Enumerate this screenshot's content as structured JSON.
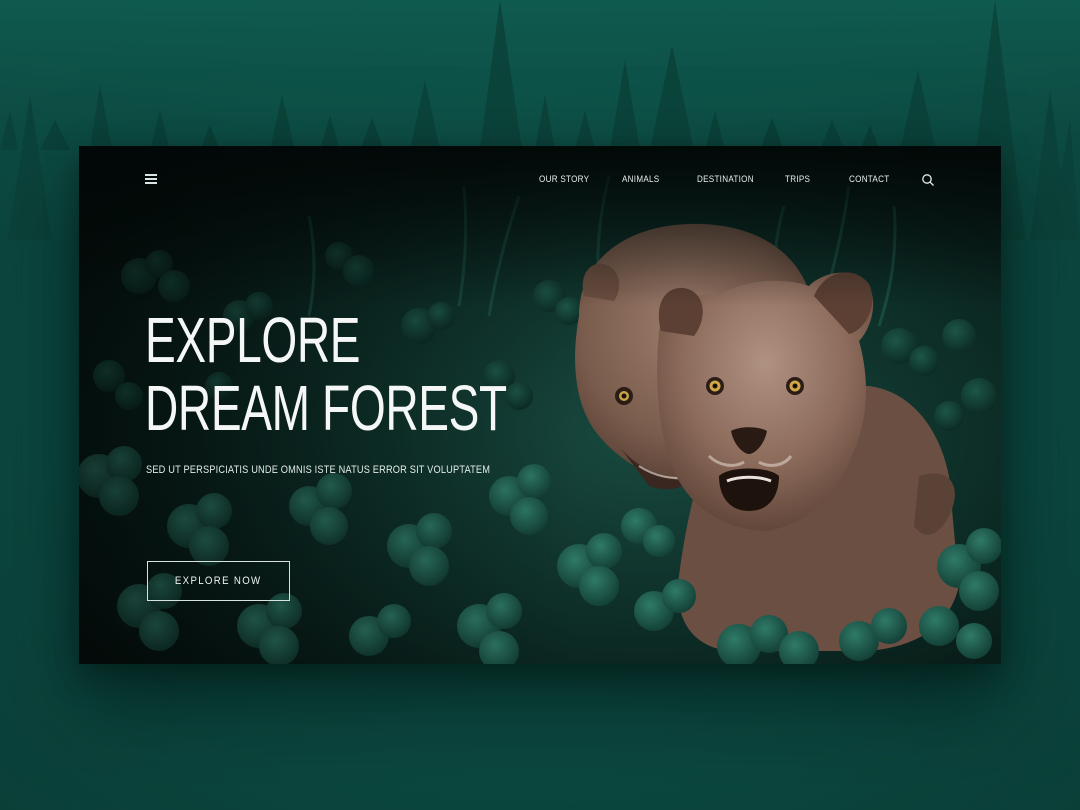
{
  "nav": {
    "menu_icon": "hamburger-menu-icon",
    "links": [
      "OUR STORY",
      "ANIMALS",
      "DESTINATION",
      "TRIPS",
      "CONTACT"
    ],
    "search_icon": "search-icon"
  },
  "hero": {
    "title_line1": "EXPLORE",
    "title_line2": "DREAM FOREST",
    "subtitle": "SED UT PERSPICIATIS UNDE OMNIS ISTE NATUS ERROR SIT VOLUPTATEM",
    "cta_label": "EXPLORE NOW",
    "image": "two-lionesses-in-green-clover"
  },
  "colors": {
    "background": "#0d4a42",
    "panel_dark": "#05100e",
    "foliage": "#1f5a4e",
    "lioness": "#8a6a5a",
    "text": "#f4f7f6"
  }
}
